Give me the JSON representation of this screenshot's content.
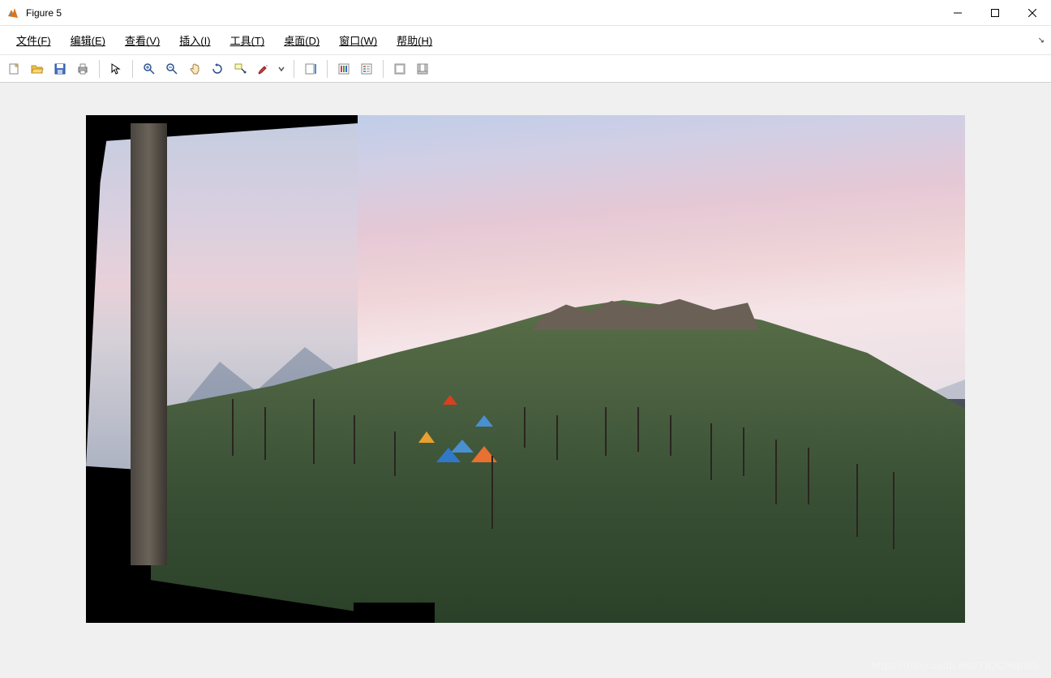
{
  "window": {
    "title": "Figure 5"
  },
  "menus": {
    "file": "文件(F)",
    "edit": "编辑(E)",
    "view": "查看(V)",
    "insert": "插入(I)",
    "tools": "工具(T)",
    "desktop": "桌面(D)",
    "window": "窗口(W)",
    "help": "帮助(H)"
  },
  "watermark": "https://blog.csdn.net/TIQCmatlab"
}
